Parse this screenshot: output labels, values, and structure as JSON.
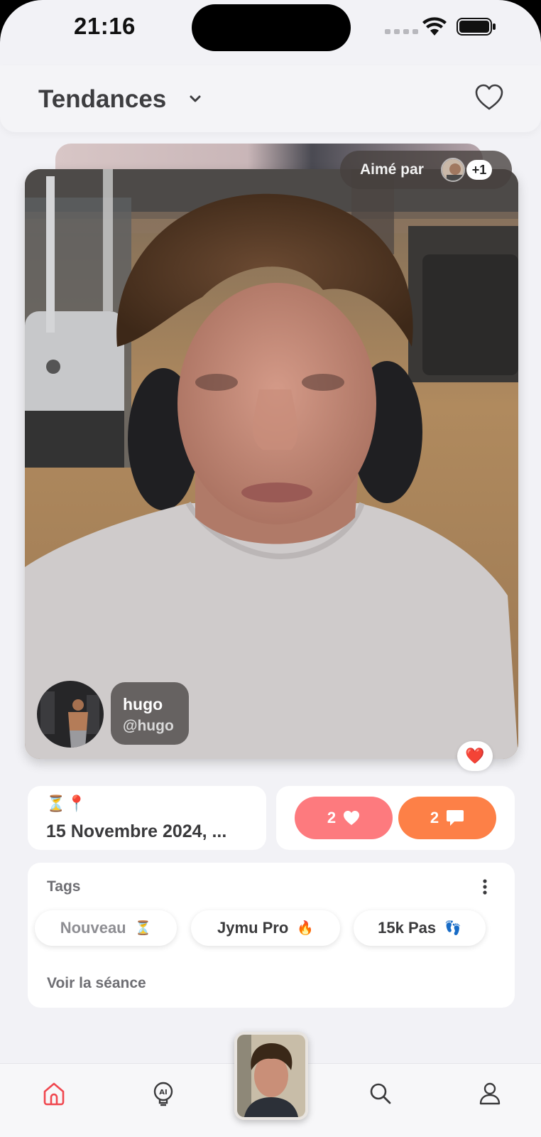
{
  "status_bar": {
    "time": "21:16"
  },
  "header": {
    "title": "Tendances"
  },
  "post": {
    "liked_by_label": "Aimé par",
    "liked_by_extra": "+1",
    "user_name": "hugo",
    "user_handle": "@hugo",
    "date_icons": "⏳📍",
    "date": "15 Novembre 2024, ...",
    "likes_count": "2",
    "comments_count": "2",
    "reaction": "❤️"
  },
  "tags": {
    "title": "Tags",
    "items": [
      {
        "label": "Nouveau",
        "icon": "⏳"
      },
      {
        "label": "Jymu Pro",
        "icon": "🔥"
      },
      {
        "label": "15k Pas",
        "icon": "👣"
      }
    ],
    "link": "Voir la séance"
  },
  "nav": [
    "home-icon",
    "ai-icon",
    "camera-thumbnail",
    "search-icon",
    "profile-icon"
  ],
  "colors": {
    "likes": "#fd7a7e",
    "comments": "#fd8047",
    "active_nav": "#f0474f"
  }
}
